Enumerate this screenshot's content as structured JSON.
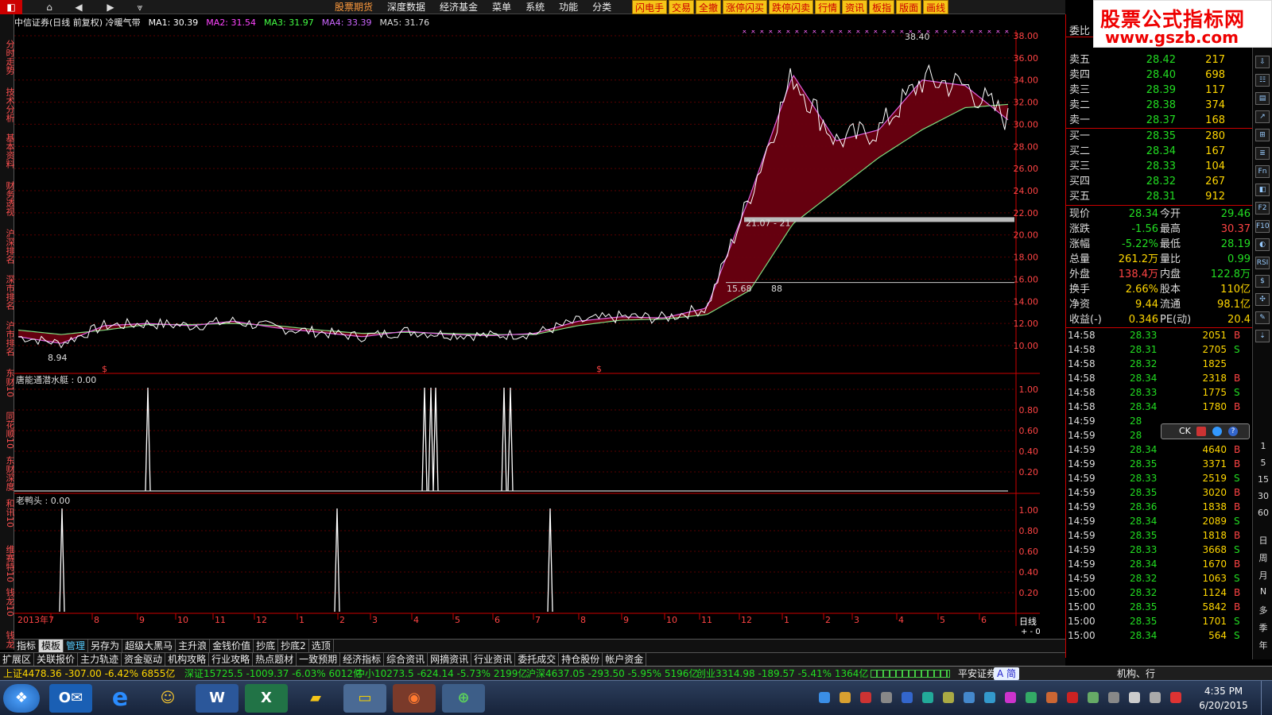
{
  "stock": {
    "name_period": "中信证券(日线 前复权) 冷暖气带",
    "ma": [
      {
        "label": "MA1: 30.39",
        "color": "#ffffff"
      },
      {
        "label": "MA2: 31.54",
        "color": "#ff44ff"
      },
      {
        "label": "MA3: 31.97",
        "color": "#44ff44"
      },
      {
        "label": "MA4: 33.39",
        "color": "#cc66ff"
      },
      {
        "label": "MA5: 31.76",
        "color": "#dddddd"
      }
    ]
  },
  "top_menu": [
    "股票期货",
    "深度数据",
    "经济基金",
    "菜单",
    "系统",
    "功能",
    "分类"
  ],
  "tool_buttons": [
    "闪电手",
    "交易",
    "全撤",
    "涨停闪买",
    "跌停闪卖",
    "行情",
    "资讯",
    "板指",
    "版面",
    "画线"
  ],
  "left_tabs": [
    "分时走势",
    "技术分析",
    "基本资料",
    "财务透视",
    "沪深排名",
    "深市排名",
    "沪市排名",
    "东财10",
    "同花顺10",
    "东财深度",
    "和讯10",
    "维赛特10",
    "钱龙10",
    "钱龙"
  ],
  "price_axis": [
    "38.00",
    "36.00",
    "34.00",
    "32.00",
    "30.00",
    "28.00",
    "26.00",
    "24.00",
    "22.00",
    "20.00",
    "18.00",
    "16.00",
    "14.00",
    "12.00",
    "10.00"
  ],
  "annotations": {
    "high": "38.40",
    "low": "8.94",
    "zone1": "21.07 - 21",
    "zone2": "15.68",
    "zone2b": "88"
  },
  "indicator1": {
    "title": "唐能通潜水艇 : 0.00",
    "axis": [
      "1.00",
      "0.80",
      "0.60",
      "0.40",
      "0.20"
    ]
  },
  "indicator2": {
    "title": "老鸭头 : 0.00",
    "axis": [
      "1.00",
      "0.80",
      "0.60",
      "0.40",
      "0.20"
    ]
  },
  "months": [
    "2013年7",
    "8",
    "9",
    "10",
    "11",
    "12",
    "1",
    "2",
    "3",
    "4",
    "5",
    "6",
    "7",
    "8",
    "9",
    "10",
    "11",
    "12",
    "1",
    "2",
    "3",
    "4",
    "5",
    "6"
  ],
  "period_label": "日线",
  "order_book": {
    "header": "委比",
    "sells": [
      {
        "label": "卖五",
        "price": "28.42",
        "vol": "217"
      },
      {
        "label": "卖四",
        "price": "28.40",
        "vol": "698"
      },
      {
        "label": "卖三",
        "price": "28.39",
        "vol": "117"
      },
      {
        "label": "卖二",
        "price": "28.38",
        "vol": "374"
      },
      {
        "label": "卖一",
        "price": "28.37",
        "vol": "168"
      }
    ],
    "buys": [
      {
        "label": "买一",
        "price": "28.35",
        "vol": "280"
      },
      {
        "label": "买二",
        "price": "28.34",
        "vol": "167"
      },
      {
        "label": "买三",
        "price": "28.33",
        "vol": "104"
      },
      {
        "label": "买四",
        "price": "28.32",
        "vol": "267"
      },
      {
        "label": "买五",
        "price": "28.31",
        "vol": "912"
      }
    ]
  },
  "quote": [
    {
      "l1": "现价",
      "v1": "28.34",
      "c1": "#22dd22",
      "l2": "今开",
      "v2": "29.46",
      "c2": "#22dd22"
    },
    {
      "l1": "涨跌",
      "v1": "-1.56",
      "c1": "#22dd22",
      "l2": "最高",
      "v2": "30.37",
      "c2": "#ff4444"
    },
    {
      "l1": "涨幅",
      "v1": "-5.22%",
      "c1": "#22dd22",
      "l2": "最低",
      "v2": "28.19",
      "c2": "#22dd22"
    },
    {
      "l1": "总量",
      "v1": "261.2万",
      "c1": "#ffd700",
      "l2": "量比",
      "v2": "0.99",
      "c2": "#22dd22"
    },
    {
      "l1": "外盘",
      "v1": "138.4万",
      "c1": "#ff4444",
      "l2": "内盘",
      "v2": "122.8万",
      "c2": "#22dd22"
    },
    {
      "l1": "换手",
      "v1": "2.66%",
      "c1": "#ffd700",
      "l2": "股本",
      "v2": "110亿",
      "c2": "#ffd700"
    },
    {
      "l1": "净资",
      "v1": "9.44",
      "c1": "#ffd700",
      "l2": "流通",
      "v2": "98.1亿",
      "c2": "#ffd700"
    },
    {
      "l1": "收益(-)",
      "v1": "0.346",
      "c1": "#ffd700",
      "l2": "PE(动)",
      "v2": "20.4",
      "c2": "#ffd700"
    }
  ],
  "ticks": [
    {
      "t": "14:58",
      "p": "28.33",
      "v": "2051",
      "s": "B"
    },
    {
      "t": "14:58",
      "p": "28.31",
      "v": "2705",
      "s": "S"
    },
    {
      "t": "14:58",
      "p": "28.32",
      "v": "1825",
      "s": ""
    },
    {
      "t": "14:58",
      "p": "28.34",
      "v": "2318",
      "s": "B"
    },
    {
      "t": "14:58",
      "p": "28.33",
      "v": "1775",
      "s": "S"
    },
    {
      "t": "14:58",
      "p": "28.34",
      "v": "1780",
      "s": "B"
    },
    {
      "t": "14:59",
      "p": "28",
      "v": "",
      "s": ""
    },
    {
      "t": "14:59",
      "p": "28",
      "v": "",
      "s": ""
    },
    {
      "t": "14:59",
      "p": "28.34",
      "v": "4640",
      "s": "B"
    },
    {
      "t": "14:59",
      "p": "28.35",
      "v": "3371",
      "s": "B"
    },
    {
      "t": "14:59",
      "p": "28.33",
      "v": "2519",
      "s": "S"
    },
    {
      "t": "14:59",
      "p": "28.35",
      "v": "3020",
      "s": "B"
    },
    {
      "t": "14:59",
      "p": "28.36",
      "v": "1838",
      "s": "B"
    },
    {
      "t": "14:59",
      "p": "28.34",
      "v": "2089",
      "s": "S"
    },
    {
      "t": "14:59",
      "p": "28.35",
      "v": "1818",
      "s": "B"
    },
    {
      "t": "14:59",
      "p": "28.33",
      "v": "3668",
      "s": "S"
    },
    {
      "t": "14:59",
      "p": "28.34",
      "v": "1670",
      "s": "B"
    },
    {
      "t": "14:59",
      "p": "28.32",
      "v": "1063",
      "s": "S"
    },
    {
      "t": "15:00",
      "p": "28.32",
      "v": "1124",
      "s": "B"
    },
    {
      "t": "15:00",
      "p": "28.35",
      "v": "5842",
      "s": "B"
    },
    {
      "t": "15:00",
      "p": "28.35",
      "v": "1701",
      "s": "S"
    },
    {
      "t": "15:00",
      "p": "28.34",
      "v": "564",
      "s": "S"
    }
  ],
  "right_strip_tabs": [
    "日",
    "周",
    "月",
    "N",
    "多",
    "季",
    "年"
  ],
  "right_strip_nums": [
    "1",
    "5",
    "15",
    "30",
    "60"
  ],
  "logo": {
    "line1": "股票公式指标网",
    "line2": "www.gszb.com"
  },
  "tabs_row1": [
    "指标",
    "模板",
    "管理",
    "另存为",
    "超级大黑马",
    "主升浪",
    "金钱价值",
    "抄底",
    "抄底2",
    "选顶"
  ],
  "tabs_row2": [
    "扩展区",
    "关联报价",
    "主力轨迹",
    "资金驱动",
    "机构攻略",
    "行业攻略",
    "热点题材",
    "一致预期",
    "经济指标",
    "综合资讯",
    "网摘资讯",
    "行业资讯",
    "委托成交",
    "持仓股份",
    "帐户资金"
  ],
  "status": {
    "sh": "上证4478.36 -307.00 -6.42% 6855亿",
    "sz": "深证15725.5 -1009.37 -6.03% 6012亿",
    "zx": "中小10273.5 -624.14 -5.73% 2199亿",
    "hs": "沪深4637.05 -293.50 -5.95% 5196亿",
    "cy": "创业3314.98 -189.57 -5.41% 1364亿",
    "broker": "平安证券",
    "ime": "A 简",
    "right": "机构、行"
  },
  "taskbar": {
    "time": "4:35 PM",
    "date": "6/20/2015"
  },
  "ck_label": "CK",
  "colors": {
    "up": "#ff4444",
    "down": "#22dd22",
    "accent_red": "#cc0000",
    "warm_band": "#6a0010",
    "cold_band": "#0a5a1a"
  },
  "chart_data": {
    "type": "line",
    "title": "中信证券(日线 前复权) 冷暖气带",
    "ylim": [
      8,
      39
    ],
    "x": [
      "2013-07",
      "2013-08",
      "2013-09",
      "2013-10",
      "2013-11",
      "2013-12",
      "2014-01",
      "2014-02",
      "2014-03",
      "2014-04",
      "2014-05",
      "2014-06",
      "2014-07",
      "2014-08",
      "2014-09",
      "2014-10",
      "2014-11",
      "2014-12",
      "2015-01",
      "2015-02",
      "2015-03",
      "2015-04",
      "2015-05",
      "2015-06"
    ],
    "series": [
      {
        "name": "MA1",
        "values": [
          10.8,
          10.2,
          11.8,
          12.0,
          11.8,
          12.2,
          11.6,
          11.2,
          10.8,
          11.3,
          11.0,
          10.9,
          11.1,
          12.2,
          12.6,
          12.5,
          13.4,
          23.5,
          34.5,
          28.5,
          29.5,
          34.0,
          33.5,
          30.4
        ]
      },
      {
        "name": "MA5",
        "values": [
          11.4,
          11.0,
          11.4,
          11.9,
          11.9,
          12.0,
          11.8,
          11.4,
          11.1,
          11.2,
          11.1,
          11.0,
          11.0,
          11.8,
          12.3,
          12.4,
          12.8,
          15.0,
          21.0,
          24.0,
          27.0,
          29.5,
          31.5,
          31.8
        ]
      }
    ],
    "low": 8.94,
    "high": 38.4
  }
}
